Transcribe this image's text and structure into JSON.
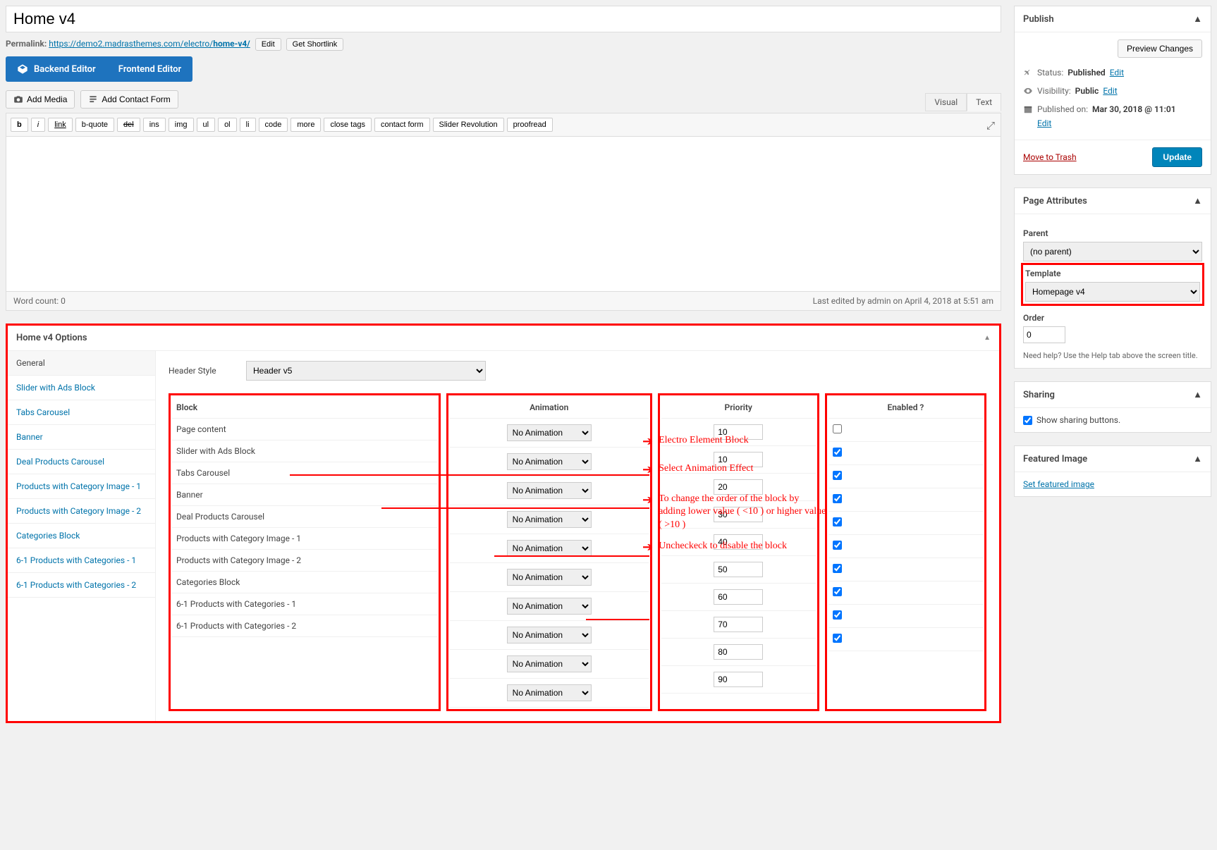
{
  "title": "Home v4",
  "permalink_label": "Permalink:",
  "permalink_base": "https://demo2.madrasthemes.com/electro/",
  "permalink_slug": "home-v4/",
  "edit_btn": "Edit",
  "shortlink_btn": "Get Shortlink",
  "backend_editor": "Backend Editor",
  "frontend_editor": "Frontend Editor",
  "add_media": "Add Media",
  "add_contact": "Add Contact Form",
  "view_visual": "Visual",
  "view_text": "Text",
  "quicktags": [
    "b",
    "i",
    "link",
    "b-quote",
    "del",
    "ins",
    "img",
    "ul",
    "ol",
    "li",
    "code",
    "more",
    "close tags",
    "contact form",
    "Slider Revolution",
    "proofread"
  ],
  "word_count": "Word count: 0",
  "last_edited": "Last edited by admin on April 4, 2018 at 5:51 am",
  "options_title": "Home v4 Options",
  "opt_nav": [
    "General",
    "Slider with Ads Block",
    "Tabs Carousel",
    "Banner",
    "Deal Products Carousel",
    "Products with Category Image - 1",
    "Products with Category Image - 2",
    "Categories Block",
    "6-1 Products with Categories - 1",
    "6-1 Products with Categories - 2"
  ],
  "header_style_label": "Header Style",
  "header_style_value": "Header v5",
  "th_block": "Block",
  "th_anim": "Animation",
  "th_prio": "Priority",
  "th_enabled": "Enabled ?",
  "anim_default": "No Animation",
  "blocks": [
    {
      "name": "Page content",
      "prio": "10",
      "enabled": false
    },
    {
      "name": "Slider with Ads Block",
      "prio": "10",
      "enabled": true
    },
    {
      "name": "Tabs Carousel",
      "prio": "20",
      "enabled": true
    },
    {
      "name": "Banner",
      "prio": "30",
      "enabled": true
    },
    {
      "name": "Deal Products Carousel",
      "prio": "40",
      "enabled": true
    },
    {
      "name": "Products with Category Image - 1",
      "prio": "50",
      "enabled": true
    },
    {
      "name": "Products with Category Image - 2",
      "prio": "60",
      "enabled": true
    },
    {
      "name": "Categories Block",
      "prio": "70",
      "enabled": true
    },
    {
      "name": "6-1 Products with Categories - 1",
      "prio": "80",
      "enabled": true
    },
    {
      "name": "6-1 Products with Categories - 2",
      "prio": "90",
      "enabled": true
    }
  ],
  "annotations": {
    "a1": "Electro Element Block",
    "a2": "Select Animation Effect",
    "a3": "To change the  order of the block  by adding lower value ( <10 ) or higher value ( >10 )",
    "a4": "Uncheckeck to disable the block"
  },
  "publish": {
    "title": "Publish",
    "preview": "Preview Changes",
    "status_lbl": "Status:",
    "status_val": "Published",
    "vis_lbl": "Visibility:",
    "vis_val": "Public",
    "pubdate_lbl": "Published on:",
    "pubdate_val": "Mar 30, 2018 @ 11:01",
    "edit": "Edit",
    "trash": "Move to Trash",
    "update": "Update"
  },
  "page_attr": {
    "title": "Page Attributes",
    "parent_lbl": "Parent",
    "parent_val": "(no parent)",
    "template_lbl": "Template",
    "template_val": "Homepage v4",
    "order_lbl": "Order",
    "order_val": "0",
    "help": "Need help? Use the Help tab above the screen title."
  },
  "sharing": {
    "title": "Sharing",
    "chk": "Show sharing buttons."
  },
  "featured": {
    "title": "Featured Image",
    "link": "Set featured image"
  }
}
